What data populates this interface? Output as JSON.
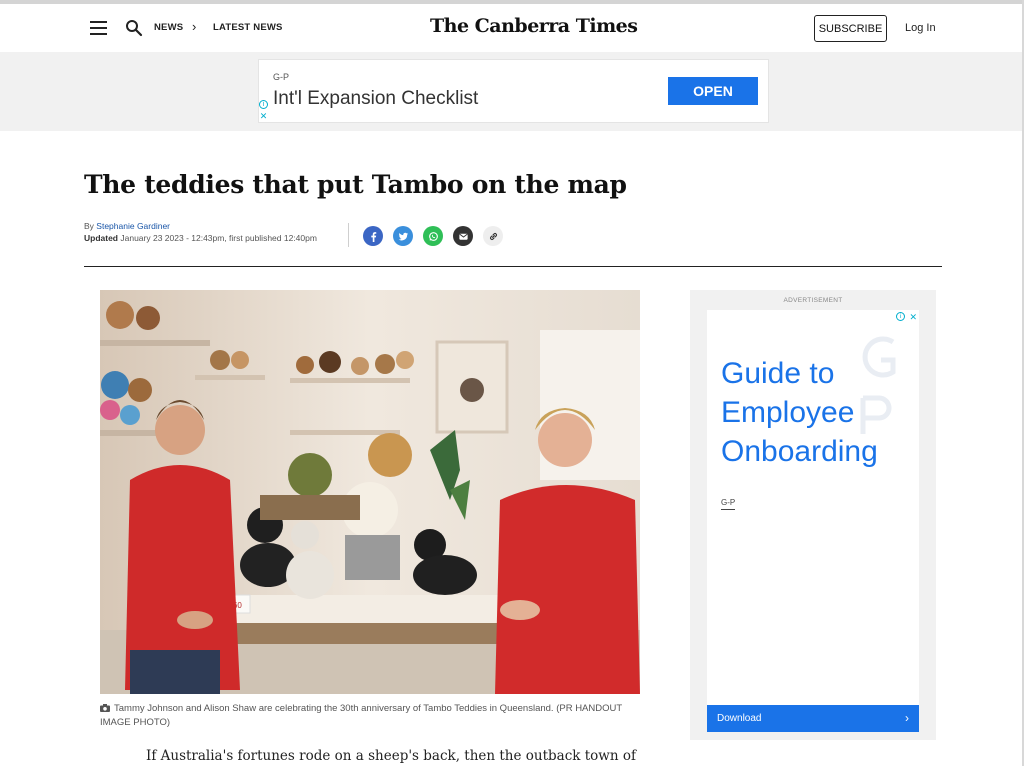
{
  "header": {
    "breadcrumb": [
      "NEWS",
      "LATEST NEWS"
    ],
    "logo": "The Canberra Times",
    "subscribe_label": "SUBSCRIBE",
    "login_label": "Log In"
  },
  "top_ad": {
    "brand": "G-P",
    "title": "Int'l Expansion Checklist",
    "cta": "OPEN",
    "info_icon": "i",
    "close_icon": "✕"
  },
  "article": {
    "headline": "The teddies that put Tambo on the map",
    "byline_prefix": "By",
    "author": "Stephanie Gardiner",
    "updated_label": "Updated",
    "updated_text": "January 23 2023 - 12:43pm, first published 12:40pm",
    "share_icons": [
      "facebook-icon",
      "twitter-icon",
      "whatsapp-icon",
      "email-icon",
      "link-icon"
    ],
    "photo_price_tag": "$160",
    "caption": "Tammy Johnson and Alison Shaw are celebrating the 30th anniversary of Tambo Teddies in Queensland. (PR HANDOUT IMAGE PHOTO)",
    "body_first_line": "If Australia's fortunes rode on a sheep's back, then the outback town of"
  },
  "side_ad": {
    "label": "ADVERTISEMENT",
    "title": "Guide to Employee Onboarding",
    "brand": "G-P",
    "cta": "Download",
    "arrow": "›",
    "close_icon": "✕",
    "info_icon": "i",
    "accent_color": "#1a73e8"
  }
}
